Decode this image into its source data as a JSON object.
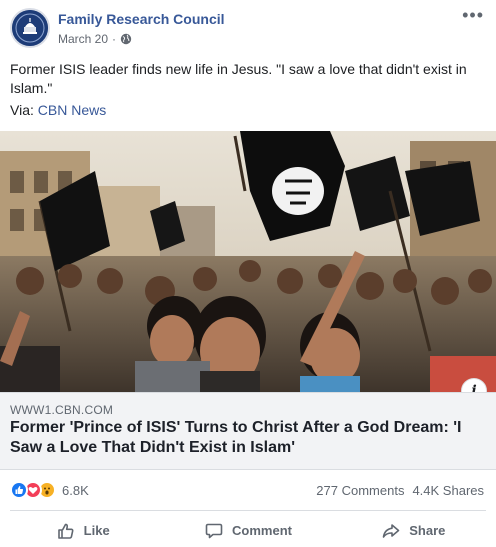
{
  "post": {
    "page_name": "Family Research Council",
    "date": "March 20",
    "privacy_icon": "globe-icon",
    "more_icon": "more-icon",
    "text": "Former ISIS leader finds new life in Jesus. \"I saw a love that didn't exist in Islam.\"",
    "via_label": "Via:",
    "via_source": "CBN News"
  },
  "link_preview": {
    "domain": "WWW1.CBN.COM",
    "headline": "Former 'Prince of ISIS' Turns to Christ After a God Dream: 'I Saw a Love That Didn't Exist in Islam'",
    "info_glyph": "i"
  },
  "engagement": {
    "reaction_icons": [
      "like-reaction-icon",
      "love-reaction-icon",
      "wow-reaction-icon"
    ],
    "reaction_count": "6.8K",
    "comments": "277 Comments",
    "shares": "4.4K Shares"
  },
  "actions": {
    "like_label": "Like",
    "comment_label": "Comment",
    "share_label": "Share"
  },
  "colors": {
    "link_blue": "#385898",
    "like_blue": "#1877f2",
    "love_red": "#f33e58",
    "wow_yellow": "#f7b125"
  }
}
